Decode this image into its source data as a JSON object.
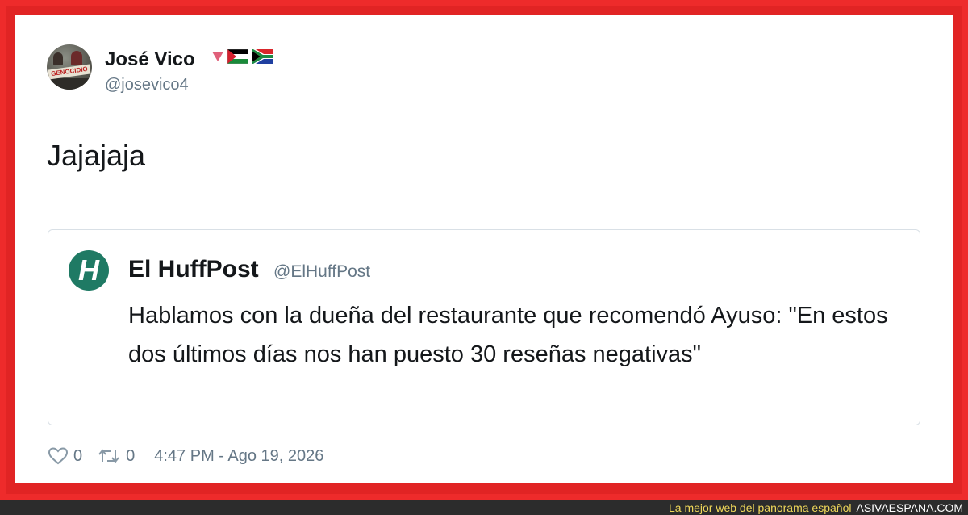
{
  "tweet": {
    "author_name": "José Vico",
    "author_handle": "@josevico4",
    "avatar_banner_text": "GENOCIDIO",
    "text": "Jajajaja",
    "likes": "0",
    "retweets": "0",
    "timestamp": "4:47 PM - Ago 19, 2026",
    "flag_icons": [
      "red-triangle-icon",
      "palestine-flag-icon",
      "south-africa-flag-icon"
    ]
  },
  "quoted": {
    "author_name": "El HuffPost",
    "author_handle": "@ElHuffPost",
    "logo_letter": "H",
    "text": "Hablamos con la dueña del restaurante que recomendó Ayuso: \"En estos dos últimos días nos han puesto 30 reseñas negativas\""
  },
  "footer": {
    "tagline": "La mejor web del panorama español",
    "site": "ASIVAESPANA.COM"
  },
  "colors": {
    "frame": "#e12424",
    "text": "#14171a",
    "muted": "#657786",
    "huffpost": "#1f7a64",
    "footer_bg": "#2c2c2c",
    "footer_tag": "#f0d85a"
  }
}
